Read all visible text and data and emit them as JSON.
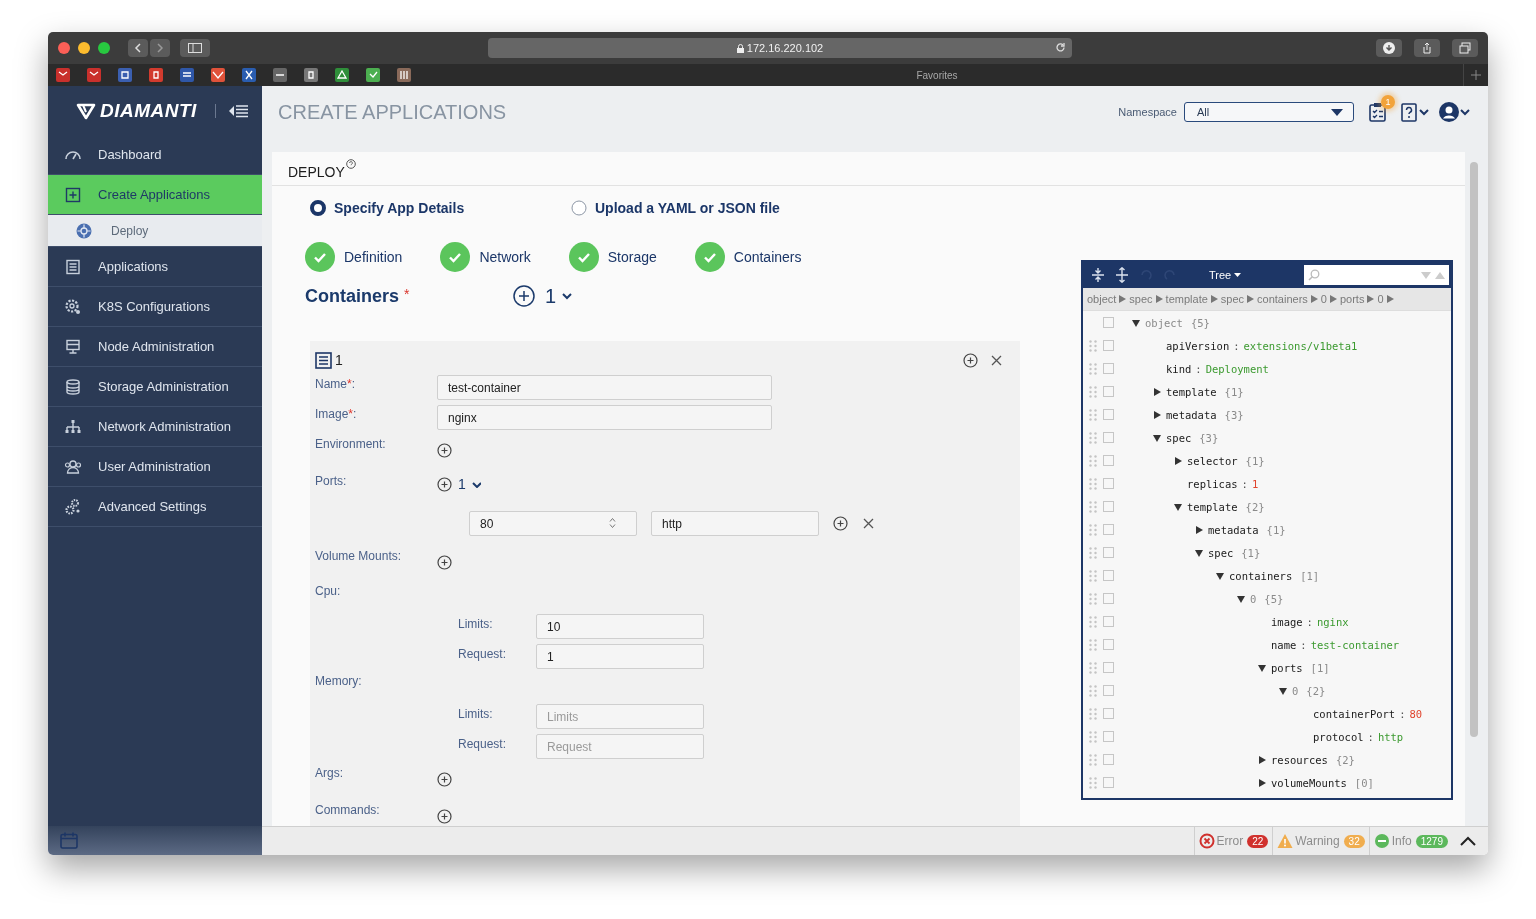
{
  "browser": {
    "address": "172.16.220.102",
    "favorites_label": "Favorites"
  },
  "sidebar": {
    "logo": "DIAMANTI",
    "items": [
      {
        "label": "Dashboard",
        "selected": false
      },
      {
        "label": "Create Applications",
        "selected": true,
        "children": [
          {
            "label": "Deploy",
            "selected": true
          }
        ]
      },
      {
        "label": "Applications",
        "selected": false
      },
      {
        "label": "K8S Configurations",
        "selected": false
      },
      {
        "label": "Node Administration",
        "selected": false
      },
      {
        "label": "Storage Administration",
        "selected": false
      },
      {
        "label": "Network Administration",
        "selected": false
      },
      {
        "label": "User Administration",
        "selected": false
      },
      {
        "label": "Advanced Settings",
        "selected": false
      }
    ]
  },
  "header": {
    "title": "CREATE APPLICATIONS",
    "namespace_label": "Namespace",
    "namespace_value": "All",
    "notification_count": "1"
  },
  "deploy": {
    "title": "DEPLOY",
    "modes": [
      {
        "label": "Specify App Details",
        "selected": true
      },
      {
        "label": "Upload a YAML or JSON file",
        "selected": false
      }
    ],
    "steps": [
      {
        "label": "Definition",
        "done": true
      },
      {
        "label": "Network",
        "done": true
      },
      {
        "label": "Storage",
        "done": true
      },
      {
        "label": "Containers",
        "done": true
      }
    ],
    "containers": {
      "label": "Containers",
      "required_mark": "*",
      "count": "1",
      "items": [
        {
          "index": "1",
          "fields": [
            {
              "kind": "text",
              "label": "Name",
              "required_mark": "*",
              "label_end": ":",
              "value": "test-container"
            },
            {
              "kind": "text",
              "label": "Image",
              "required_mark": "*",
              "label_end": ":",
              "value": "nginx"
            },
            {
              "kind": "add",
              "label": "Environment:"
            },
            {
              "kind": "ports",
              "label": "Ports:",
              "count": "1",
              "entries": [
                {
                  "port": "80",
                  "protocol": "http"
                }
              ]
            },
            {
              "kind": "add",
              "label": "Volume Mounts:"
            },
            {
              "kind": "group",
              "label": "Cpu:",
              "fields": [
                {
                  "label": "Limits:",
                  "value": "10"
                },
                {
                  "label": "Request:",
                  "value": "1"
                }
              ]
            },
            {
              "kind": "group",
              "label": "Memory:",
              "fields": [
                {
                  "label": "Limits:",
                  "placeholder": "Limits"
                },
                {
                  "label": "Request:",
                  "placeholder": "Request"
                }
              ]
            },
            {
              "kind": "add",
              "label": "Args:"
            },
            {
              "kind": "add",
              "label": "Commands:"
            }
          ]
        }
      ]
    }
  },
  "tree": {
    "mode": "Tree",
    "separator": ":",
    "breadcrumb": [
      "object",
      "spec",
      "template",
      "spec",
      "containers",
      "0",
      "ports",
      "0"
    ],
    "root": {
      "key": "object",
      "editable": false,
      "checked": false,
      "kind": "object",
      "count": "{5}",
      "expanded": true,
      "children": [
        {
          "key": "apiVersion",
          "editable": true,
          "checked": false,
          "kind": "string",
          "value": "extensions/v1beta1"
        },
        {
          "key": "kind",
          "editable": true,
          "checked": false,
          "kind": "string",
          "value": "Deployment"
        },
        {
          "key": "template",
          "editable": true,
          "checked": false,
          "kind": "object",
          "count": "{1}",
          "expanded": false
        },
        {
          "key": "metadata",
          "editable": true,
          "checked": false,
          "kind": "object",
          "count": "{3}",
          "expanded": false
        },
        {
          "key": "spec",
          "editable": true,
          "checked": false,
          "kind": "object",
          "count": "{3}",
          "expanded": true,
          "children": [
            {
              "key": "selector",
              "editable": true,
              "checked": false,
              "kind": "object",
              "count": "{1}",
              "expanded": false
            },
            {
              "key": "replicas",
              "editable": true,
              "checked": false,
              "kind": "number",
              "value": "1"
            },
            {
              "key": "template",
              "editable": true,
              "checked": false,
              "kind": "object",
              "count": "{2}",
              "expanded": true,
              "children": [
                {
                  "key": "metadata",
                  "editable": true,
                  "checked": false,
                  "kind": "object",
                  "count": "{1}",
                  "expanded": false
                },
                {
                  "key": "spec",
                  "editable": true,
                  "checked": false,
                  "kind": "object",
                  "count": "{1}",
                  "expanded": true,
                  "children": [
                    {
                      "key": "containers",
                      "editable": true,
                      "checked": false,
                      "kind": "array",
                      "count": "[1]",
                      "expanded": true,
                      "children": [
                        {
                          "key": "0",
                          "editable": false,
                          "checked": false,
                          "kind": "object",
                          "count": "{5}",
                          "expanded": true,
                          "children": [
                            {
                              "key": "image",
                              "editable": true,
                              "checked": false,
                              "kind": "string",
                              "value": "nginx"
                            },
                            {
                              "key": "name",
                              "editable": true,
                              "checked": false,
                              "kind": "string",
                              "value": "test-container"
                            },
                            {
                              "key": "ports",
                              "editable": true,
                              "checked": false,
                              "kind": "array",
                              "count": "[1]",
                              "expanded": true,
                              "children": [
                                {
                                  "key": "0",
                                  "editable": false,
                                  "checked": false,
                                  "kind": "object",
                                  "count": "{2}",
                                  "expanded": true,
                                  "children": [
                                    {
                                      "key": "containerPort",
                                      "editable": true,
                                      "checked": false,
                                      "kind": "number",
                                      "value": "80"
                                    },
                                    {
                                      "key": "protocol",
                                      "editable": true,
                                      "checked": false,
                                      "kind": "string",
                                      "value": "http"
                                    }
                                  ]
                                }
                              ]
                            },
                            {
                              "key": "resources",
                              "editable": true,
                              "checked": false,
                              "kind": "object",
                              "count": "{2}",
                              "expanded": false
                            },
                            {
                              "key": "volumeMounts",
                              "editable": true,
                              "checked": false,
                              "kind": "array",
                              "count": "[0]",
                              "expanded": false
                            }
                          ]
                        }
                      ]
                    }
                  ]
                }
              ]
            }
          ]
        }
      ]
    }
  },
  "status_bar": {
    "items": [
      {
        "kind": "error",
        "label": "Error",
        "count": "22",
        "color": "#d0312d"
      },
      {
        "kind": "warning",
        "label": "Warning",
        "count": "32",
        "color": "#f0ad4e"
      },
      {
        "kind": "info",
        "label": "Info",
        "count": "1279",
        "color": "#5cb85c"
      }
    ]
  }
}
